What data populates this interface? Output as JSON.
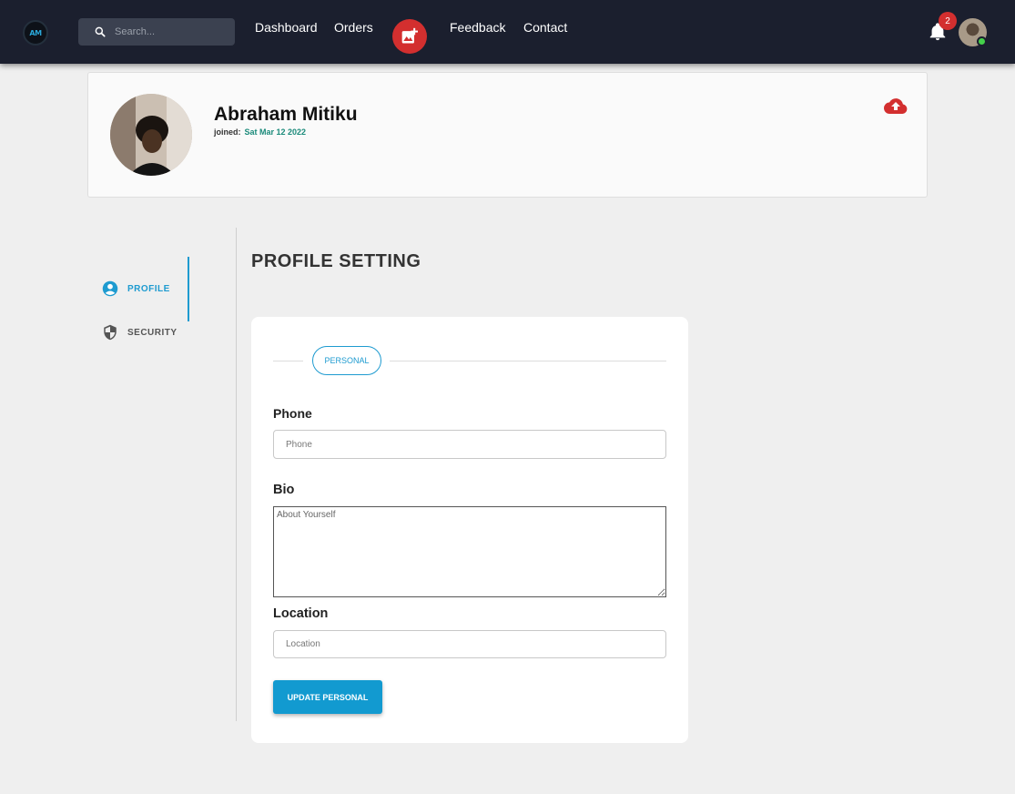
{
  "nav": {
    "logo_text": "AM",
    "search_placeholder": "Search...",
    "links": [
      "Dashboard",
      "Orders",
      "Feedback",
      "Contact"
    ],
    "notification_count": "2",
    "accent_color": "#d32f2f",
    "online_color": "#44d04a"
  },
  "profile": {
    "name": "Abraham Mitiku",
    "joined_label": "joined:",
    "joined_date": "Sat Mar 12 2022"
  },
  "side_menu": {
    "items": [
      {
        "label": "PROFILE",
        "icon": "account-circle-icon",
        "active": true
      },
      {
        "label": "SECURITY",
        "icon": "shield-icon",
        "active": false
      }
    ]
  },
  "settings": {
    "title": "PROFILE SETTING",
    "section_label": "PERSONAL",
    "phone_label": "Phone",
    "phone_placeholder": "Phone",
    "bio_label": "Bio",
    "bio_placeholder": "About Yourself",
    "location_label": "Location",
    "location_placeholder": "Location",
    "submit_label": "UPDATE PERSONAL",
    "primary_color": "#129ad0"
  }
}
